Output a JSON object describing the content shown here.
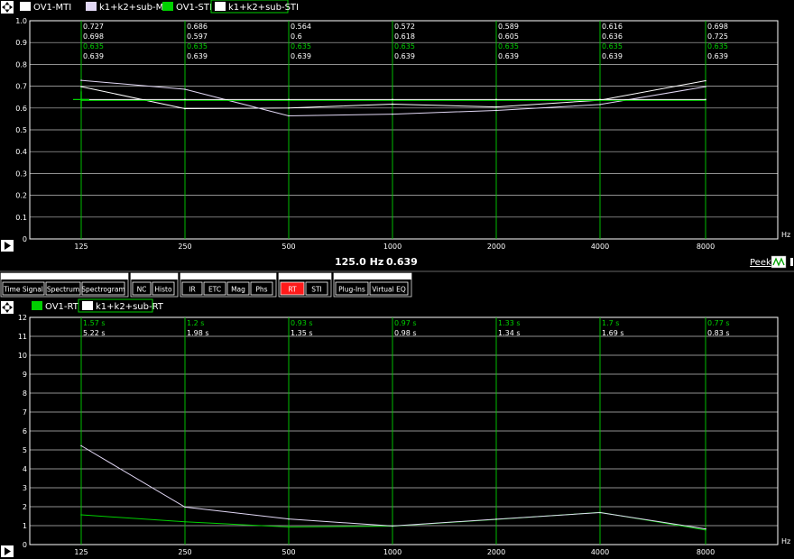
{
  "colors": {
    "background": "#000000",
    "grid": "#ffffff",
    "green": "#00d000",
    "lavender": "#e2d8f5",
    "white": "#ffffff",
    "active_tab": "#ff1a1a",
    "toolbar_bg": "#000000"
  },
  "top_panel": {
    "legend": [
      {
        "label": "OV1-MTI",
        "swatch": "#ffffff"
      },
      {
        "label": "k1+k2+sub-MTI",
        "swatch": "#e2d8f5"
      },
      {
        "label": "OV1-STI",
        "swatch": "#00d000"
      },
      {
        "label": "k1+k2+sub-STI",
        "swatch": "#ffffff",
        "selected": true
      }
    ],
    "unit": "Hz",
    "icons": [
      "move-icon",
      "play-icon"
    ]
  },
  "readout": {
    "frequency": "125.0 Hz",
    "value": "0.639",
    "peek_label": "Peek"
  },
  "toolbar": {
    "groups": [
      {
        "buttons": [
          {
            "label": "Time Signal"
          },
          {
            "label": "Spectrum"
          },
          {
            "label": "Spectrogram"
          }
        ]
      },
      {
        "buttons": [
          {
            "label": "NC"
          },
          {
            "label": "Histo"
          }
        ]
      },
      {
        "buttons": [
          {
            "label": "IR"
          },
          {
            "label": "ETC"
          },
          {
            "label": "Mag"
          },
          {
            "label": "Phs"
          }
        ]
      },
      {
        "buttons": [
          {
            "label": "RT",
            "active": true
          },
          {
            "label": "STI"
          }
        ]
      },
      {
        "buttons": [
          {
            "label": "Plug-Ins"
          },
          {
            "label": "Virtual EQ"
          }
        ]
      }
    ]
  },
  "bottom_panel": {
    "legend": [
      {
        "label": "OV1-RT",
        "swatch": "#00d000"
      },
      {
        "label": "k1+k2+sub-RT",
        "swatch": "#ffffff",
        "selected": true
      }
    ],
    "unit": "Hz",
    "icons": [
      "move-icon",
      "play-icon"
    ]
  },
  "chart_data": [
    {
      "type": "line",
      "categories": [
        "125",
        "250",
        "500",
        "1000",
        "2000",
        "4000",
        "8000"
      ],
      "ylim": [
        0,
        1
      ],
      "y_ticks": [
        "0",
        "0.1",
        "0.2",
        "0.3",
        "0.4",
        "0.5",
        "0.6",
        "0.7",
        "0.8",
        "0.9",
        "1.0"
      ],
      "grid": true,
      "series": [
        {
          "name": "OV1-MTI",
          "color": "#ffffff",
          "values": [
            0.698,
            0.597,
            0.6,
            0.618,
            0.605,
            0.636,
            0.725
          ],
          "labels": [
            "0.698",
            "0.597",
            "0.6",
            "0.618",
            "0.605",
            "0.636",
            "0.725"
          ]
        },
        {
          "name": "k1+k2+sub-MTI",
          "color": "#e2d8f5",
          "values": [
            0.727,
            0.686,
            0.564,
            0.572,
            0.589,
            0.616,
            0.698
          ],
          "labels": [
            "0.727",
            "0.686",
            "0.564",
            "0.572",
            "0.589",
            "0.616",
            "0.698"
          ]
        },
        {
          "name": "OV1-STI",
          "color": "#00d000",
          "values": [
            0.635,
            0.635,
            0.635,
            0.635,
            0.635,
            0.635,
            0.635
          ],
          "labels": [
            "0.635",
            "0.635",
            "0.635",
            "0.635",
            "0.635",
            "0.635",
            "0.635"
          ]
        },
        {
          "name": "k1+k2+sub-STI",
          "color": "#ffffff",
          "values": [
            0.639,
            0.639,
            0.639,
            0.639,
            0.639,
            0.639,
            0.639
          ],
          "labels": [
            "0.639",
            "0.639",
            "0.639",
            "0.639",
            "0.639",
            "0.639",
            "0.639"
          ]
        }
      ],
      "label_order": [
        1,
        0,
        2,
        3
      ],
      "cursor": {
        "category": "125",
        "value": 0.639
      }
    },
    {
      "type": "line",
      "categories": [
        "125",
        "250",
        "500",
        "1000",
        "2000",
        "4000",
        "8000"
      ],
      "ylim": [
        0,
        12
      ],
      "y_ticks": [
        "0",
        "1",
        "2",
        "3",
        "4",
        "5",
        "6",
        "7",
        "8",
        "9",
        "10",
        "11",
        "12"
      ],
      "grid": true,
      "series": [
        {
          "name": "OV1-RT",
          "color": "#00d000",
          "values": [
            1.57,
            1.2,
            0.93,
            0.97,
            1.33,
            1.7,
            0.77
          ],
          "labels": [
            "1.57 s",
            "1.2 s",
            "0.93 s",
            "0.97 s",
            "1.33 s",
            "1.7 s",
            "0.77 s"
          ]
        },
        {
          "name": "k1+k2+sub-RT",
          "color": "#e2d8f5",
          "values": [
            5.22,
            1.98,
            1.35,
            0.98,
            1.34,
            1.69,
            0.83
          ],
          "labels": [
            "5.22 s",
            "1.98 s",
            "1.35 s",
            "0.98 s",
            "1.34 s",
            "1.69 s",
            "0.83 s"
          ]
        }
      ],
      "label_order": [
        0,
        1
      ]
    }
  ]
}
